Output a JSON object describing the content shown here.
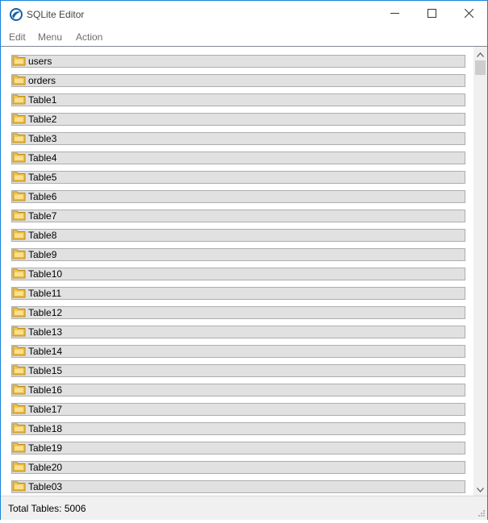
{
  "window": {
    "title": "SQLite Editor",
    "accent_color": "#1883d7"
  },
  "menu": {
    "items": [
      {
        "label": "Edit"
      },
      {
        "label": "Menu"
      },
      {
        "label": "Action"
      }
    ]
  },
  "tables": {
    "icon": "folder-icon",
    "folder_color": "#f7c948",
    "items": [
      {
        "label": "users"
      },
      {
        "label": "orders"
      },
      {
        "label": "Table1"
      },
      {
        "label": "Table2"
      },
      {
        "label": "Table3"
      },
      {
        "label": "Table4"
      },
      {
        "label": "Table5"
      },
      {
        "label": "Table6"
      },
      {
        "label": "Table7"
      },
      {
        "label": "Table8"
      },
      {
        "label": "Table9"
      },
      {
        "label": "Table10"
      },
      {
        "label": "Table11"
      },
      {
        "label": "Table12"
      },
      {
        "label": "Table13"
      },
      {
        "label": "Table14"
      },
      {
        "label": "Table15"
      },
      {
        "label": "Table16"
      },
      {
        "label": "Table17"
      },
      {
        "label": "Table18"
      },
      {
        "label": "Table19"
      },
      {
        "label": "Table20"
      },
      {
        "label": "Table03"
      }
    ]
  },
  "status": {
    "text": "Total Tables: 5006"
  }
}
